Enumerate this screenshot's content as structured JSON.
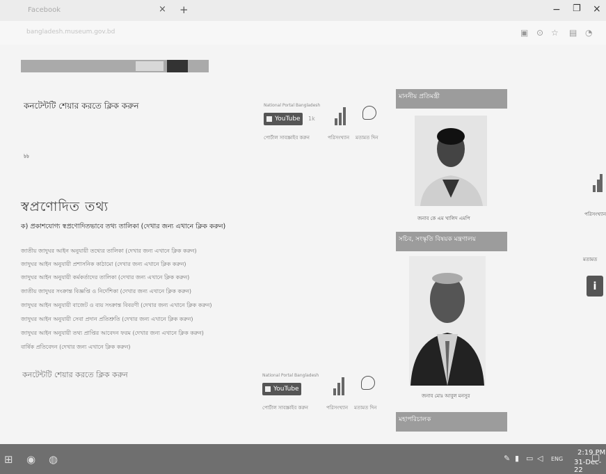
{
  "browser": {
    "tab_title": "Facebook",
    "tab_close": "×",
    "new_tab": "+",
    "url": "bangladesh.museum.gov.bd",
    "win_min": "−",
    "win_max": "❐",
    "win_close": "×"
  },
  "page": {
    "share_top": "কনটেন্টটি শেয়ার করতে ক্লিক করুন",
    "small_mark": "৳৳",
    "heading": "স্বপ্রণোদিত তথ্য",
    "subheading": "ক) প্রকাশযোগ্য স্বপ্রণোদিতভাবে তথ্য তালিকা (দেখার জন্য এখানে ক্লিক করুন)",
    "list": [
      "জাতীয় জাদুঘর আইন অনুযায়ী তথ্যের তালিকা (দেখার জন্য এখানে ক্লিক করুন)",
      "জাদুঘর আইন অনুযায়ী প্রশাসনিক কাঠামো (দেখার জন্য এখানে ক্লিক করুন)",
      "জাদুঘর আইন অনুযায়ী কর্মকর্তাদের তালিকা (দেখার জন্য এখানে ক্লিক করুন)",
      "জাতীয় জাদুঘর সংক্রান্ত বিজ্ঞপ্তি ও নির্দেশিকা (দেখার জন্য এখানে ক্লিক করুন)",
      "জাদুঘর আইন অনুযায়ী বাজেট ও ব্যয় সংক্রান্ত বিবরণী (দেখার জন্য এখানে ক্লিক করুন)",
      "জাদুঘর আইন অনুযায়ী সেবা প্রদান প্রতিশ্রুতি (দেখার জন্য এখানে ক্লিক করুন)",
      "জাদুঘর আইন অনুযায়ী তথ্য প্রাপ্তির আবেদন ফরম (দেখার জন্য এখানে ক্লিক করুন)",
      "বার্ষিক প্রতিবেদন (দেখার জন্য এখানে ক্লিক করুন)"
    ],
    "share_bottom": "কনটেন্টটি শেয়ার করতে ক্লিক করুন"
  },
  "social": {
    "label": "National Portal Bangladesh",
    "youtube": "YouTube",
    "count": "1k",
    "sub_subscribe": "পোর্টাল সাবস্ক্রাইব করুন",
    "sub_stats": "পরিসংখ্যান",
    "sub_feedback": "মতামত দিন"
  },
  "sidebar": {
    "head1": "মাননীয় প্রতিমন্ত্রী",
    "caption1": "জনাব কে এম খালিদ এমপি",
    "head2": "সচিব, সংস্কৃতি বিষয়ক মন্ত্রণালয়",
    "caption2": "জনাব মোঃ আবুল মনসুর",
    "head3": "মহাপরিচালক"
  },
  "right_rail": {
    "stats": "পরিসংখ্যান",
    "feedback": "মতামত",
    "info": "i"
  },
  "taskbar": {
    "lang": "ENG",
    "time": "2:19 PM",
    "date": "31-Dec-22"
  }
}
